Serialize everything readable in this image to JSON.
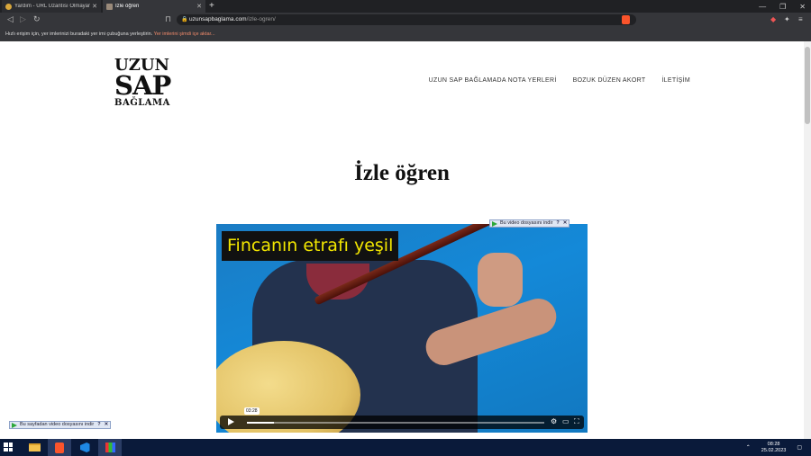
{
  "browser": {
    "tabs": [
      {
        "title": "Yardım - URL Uzantısı Olmayan Bir Vid",
        "active": false
      },
      {
        "title": "İzle öğren",
        "active": true
      }
    ],
    "url_domain": "uzunsapbaglama.com",
    "url_path": "/izle-ogren/",
    "bookmark_hint": "Hızlı erişim için, yer imlerinizi buradaki yer imi çubuğuna yerleştirin.",
    "bookmark_link": "Yer imlerini şimdi içe aktar..."
  },
  "site": {
    "logo_line1": "UZUN",
    "logo_line2": "SAP",
    "logo_line3": "BAĞLAMA",
    "menu": [
      {
        "label": "UZUN SAP BAĞLAMADA NOTA YERLERİ"
      },
      {
        "label": "BOZUK DÜZEN AKORT"
      },
      {
        "label": "İLETİŞİM"
      }
    ],
    "page_title": "İzle öğren"
  },
  "video": {
    "caption": "Fincanın etrafı yeşil",
    "time_tooltip": "03:28",
    "progress": 0.09,
    "download_top_label": "Bu video dosyasını indir",
    "download_bottom_label": "Bu sayfadan video dosyasını indir",
    "download_help": "?",
    "download_close": "✕"
  },
  "taskbar": {
    "time": "08:28",
    "date": "25.02.2023"
  },
  "colors": {
    "brand_orange": "#fb542b",
    "caption_yellow": "#f2e600",
    "taskbar": "#0a1a3a"
  }
}
